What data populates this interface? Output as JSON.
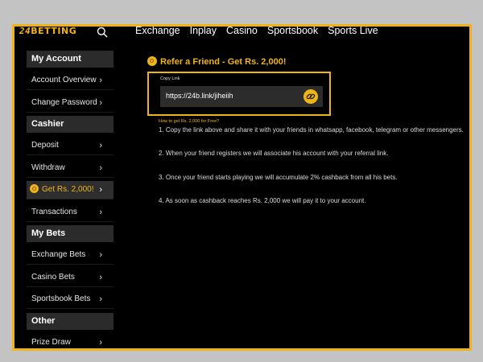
{
  "brand": {
    "logo_num": "24",
    "logo_text": "BETTING"
  },
  "nav": [
    "Exchange",
    "Inplay",
    "Casino",
    "Sportsbook",
    "Sports Live"
  ],
  "sidebar": {
    "sections": [
      {
        "title": "My Account",
        "items": [
          "Account Overview",
          "Change Password"
        ]
      },
      {
        "title": "Cashier",
        "items": [
          "Deposit",
          "Withdraw",
          "Get Rs. 2,000!",
          "Transactions"
        ]
      },
      {
        "title": "My Bets",
        "items": [
          "Exchange Bets",
          "Casino Bets",
          "Sportsbook Bets"
        ]
      },
      {
        "title": "Other",
        "items": [
          "Prize Draw"
        ]
      }
    ],
    "active_item": "Get Rs. 2,000!"
  },
  "main": {
    "title": "Refer a Friend - Get Rs. 2,000!",
    "copy_label": "Copy Link",
    "link_value": "https://24b.link/jiheiih",
    "howto": "How to get Rs. 2,000 for Free?",
    "steps": [
      "1. Copy the link above and share it with your friends in whatsapp, facebook, telegram or other messengers.",
      "2. When your friend registers we will associate his account with your referral link.",
      "3. Once your friend starts playing we will accumulate 2% cashback from all his bets.",
      "4. As soon as cashback reaches Rs. 2,000 we will pay it to your account."
    ]
  },
  "colors": {
    "accent": "#f1b418",
    "background": "#000000",
    "panel": "#2b2b2b",
    "outer": "#c3c3c3"
  },
  "icons": {
    "search": "search-icon",
    "coin": "coin-icon",
    "chevron": "chevron-right-icon",
    "copy": "link-icon"
  }
}
